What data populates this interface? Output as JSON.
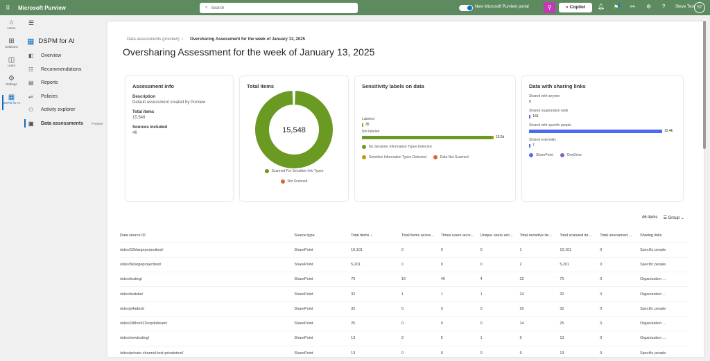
{
  "topbar": {
    "app_title": "Microsoft Purview",
    "search_placeholder": "Search",
    "portal_toggle_label": "New Microsoft Purview portal",
    "portal_toggle_on": true,
    "copilot_label": "Copilot",
    "notification_count": "1",
    "user_name": "Steve Test",
    "user_initials": "ST",
    "brand_color": "#5d8a5f"
  },
  "rail": [
    {
      "icon": "home-icon",
      "glyph": "⌂",
      "label": "Home"
    },
    {
      "icon": "solutions-icon",
      "glyph": "⊞",
      "label": "Solutions"
    },
    {
      "icon": "learn-icon",
      "glyph": "◫",
      "label": "Learn"
    },
    {
      "icon": "settings-icon",
      "glyph": "⚙",
      "label": "Settings"
    },
    {
      "icon": "dspm-icon",
      "glyph": "▦",
      "label": "DSPM for AI"
    }
  ],
  "nav": {
    "title": "DSPM for AI",
    "items": [
      {
        "label": "Overview",
        "glyph": "◧"
      },
      {
        "label": "Recommendations",
        "glyph": "☷"
      },
      {
        "label": "Reports",
        "glyph": "▤"
      },
      {
        "label": "Policies",
        "glyph": "⇌"
      },
      {
        "label": "Activity explorer",
        "glyph": "⚇"
      },
      {
        "label": "Data assessments",
        "glyph": "▣",
        "badge": "Preview"
      }
    ]
  },
  "breadcrumb": {
    "parent": "Data assessments (preview)",
    "current": "Oversharing Assessment for the week of January 13, 2025"
  },
  "page_title": "Oversharing Assessment for the week of January 13, 2025",
  "assessment_info": {
    "title": "Assessment info",
    "description_label": "Description",
    "description": "Default assessment created by Purview",
    "total_items_label": "Total items",
    "total_items": "15,548",
    "sources_label": "Sources included",
    "sources": "46"
  },
  "total_items": {
    "title": "Total items",
    "center": "15,548",
    "legend": [
      {
        "label": "Scanned For Sensitive Info Types",
        "color": "#6a9a22"
      },
      {
        "label": "Not Scanned",
        "color": "#d9652b"
      }
    ]
  },
  "sensitivity": {
    "title": "Sensitivity labels on data",
    "rows": [
      {
        "label": "Labeled",
        "value": "35",
        "fraction": 0.002
      },
      {
        "label": "Not labeled",
        "value": "15.5k",
        "fraction": 1
      }
    ],
    "legend": [
      {
        "label": "No Sensitive Information Types Detected",
        "color": "#6a9a22"
      },
      {
        "label": "Sensitive Information Types Detected",
        "color": "#c19c00"
      },
      {
        "label": "Data Not Scanned",
        "color": "#d9652b"
      }
    ]
  },
  "sharing": {
    "title": "Data with sharing links",
    "rows": [
      {
        "label": "Shared with anyone",
        "value": "0",
        "fraction": 0
      },
      {
        "label": "Shared organization wide",
        "value": "169",
        "fraction": 0.011
      },
      {
        "label": "Shared with specific people",
        "value": "15.4k",
        "fraction": 1
      },
      {
        "label": "Shared externally",
        "value": "7",
        "fraction": 0.001
      }
    ],
    "legend": [
      {
        "label": "SharePoint",
        "color": "#4f6bed"
      },
      {
        "label": "OneDrive",
        "color": "#8764b8"
      }
    ]
  },
  "table": {
    "count": "46 items",
    "group_label": "Group",
    "columns": [
      "Data source ID",
      "Source type",
      "Total items ↓",
      "Total items acces...",
      "Times users acce...",
      "Unique users acc...",
      "Total sensitive ite...",
      "Total scanned ite...",
      "Total unscanned ...",
      "Sharing links"
    ],
    "rows": [
      [
        "/sites/10klargeprojecttest/",
        "SharePoint",
        "10,101",
        "0",
        "0",
        "0",
        "1",
        "10,101",
        "0",
        "Specific people"
      ],
      [
        "/sites/5klargeprojecttest/",
        "SharePoint",
        "5,201",
        "0",
        "0",
        "0",
        "2",
        "5,201",
        "0",
        "Specific people"
      ],
      [
        "/sites/testing/",
        "SharePoint",
        "70",
        "16",
        "40",
        "4",
        "32",
        "70",
        "0",
        "Organization ..."
      ],
      [
        "/sites/testsite/",
        "SharePoint",
        "32",
        "1",
        "1",
        "1",
        "24",
        "32",
        "0",
        "Organization ..."
      ],
      [
        "/sites/p4aitest/",
        "SharePoint",
        "32",
        "0",
        "0",
        "0",
        "20",
        "32",
        "0",
        "Specific people"
      ],
      [
        "/sites/18thoct23copilotteam/",
        "SharePoint",
        "25",
        "0",
        "0",
        "0",
        "14",
        "25",
        "0",
        "Organization ..."
      ],
      [
        "/sites/newtesting/",
        "SharePoint",
        "13",
        "3",
        "5",
        "1",
        "6",
        "13",
        "0",
        "Organization ..."
      ],
      [
        "/sites/private-channel-test-privatetest/",
        "SharePoint",
        "13",
        "0",
        "0",
        "0",
        "9",
        "13",
        "0",
        "Specific people"
      ]
    ]
  }
}
